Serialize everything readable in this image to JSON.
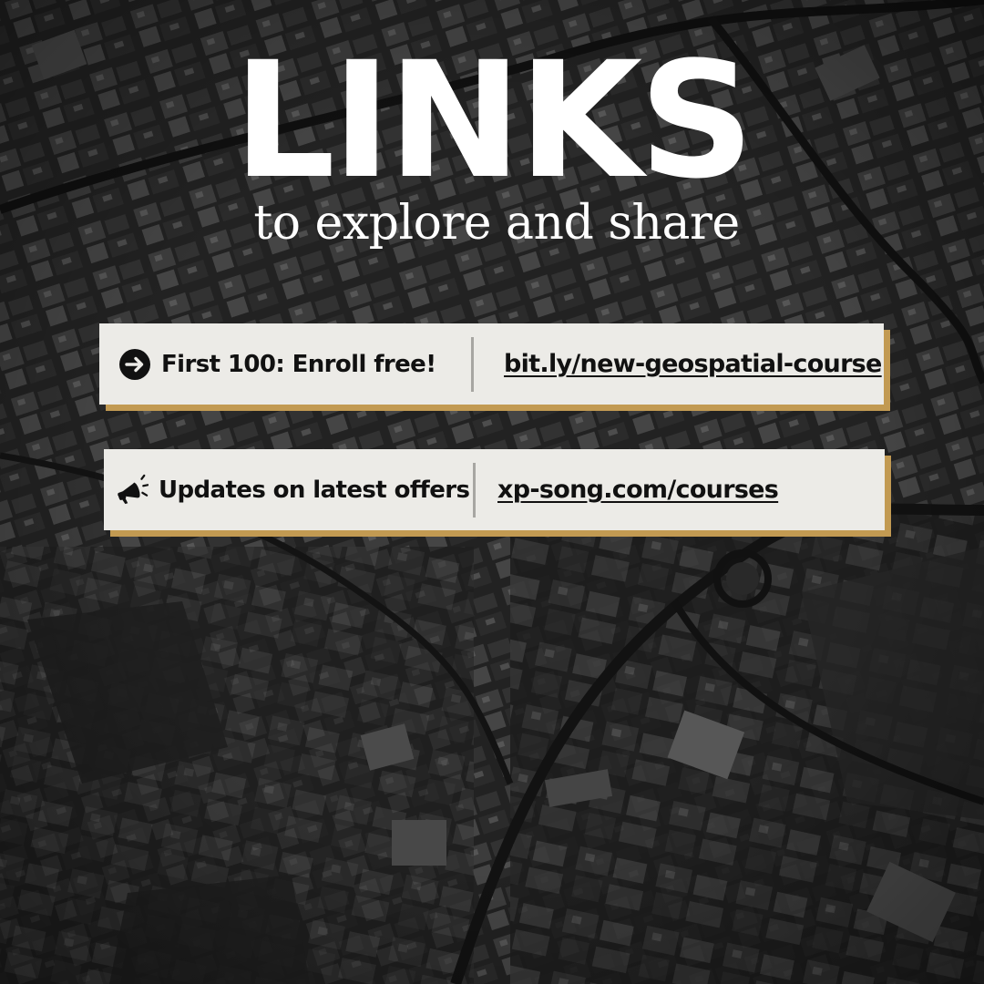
{
  "header": {
    "title": "LINKS",
    "subtitle": "to explore and share"
  },
  "links": [
    {
      "icon": "arrow-right-circle-icon",
      "label": "First 100: Enroll free!",
      "url_text": "bit.ly/new-geospatial-course"
    },
    {
      "icon": "megaphone-icon",
      "label": "Updates on latest offers",
      "url_text": "xp-song.com/courses"
    }
  ],
  "colors": {
    "card_background": "#ecebe7",
    "card_shadow_accent": "#c29a52",
    "text_dark": "#111111",
    "title_text": "#ffffff"
  }
}
